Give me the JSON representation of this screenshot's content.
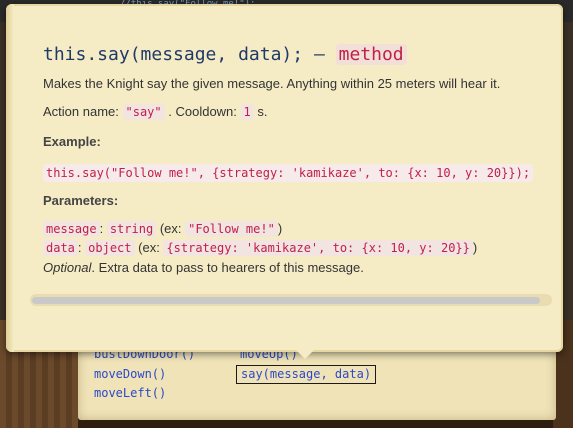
{
  "background_editor": {
    "snippet": "//this.say(\"Follow me!\");"
  },
  "popover": {
    "title_code": "this.say(message, data);",
    "title_dash": "–",
    "title_type": "method",
    "description": "Makes the Knight say the given message. Anything within 25 meters will hear it.",
    "action_name_label": "Action name:",
    "action_name_value": "\"say\"",
    "cooldown_label": ". Cooldown:",
    "cooldown_value": "1",
    "cooldown_unit": "s.",
    "example_heading": "Example:",
    "example_code": "this.say(\"Follow me!\", {strategy: 'kamikaze', to: {x: 10, y: 20}});",
    "parameters_heading": "Parameters:",
    "parameters": [
      {
        "name": "message",
        "colon": ":",
        "type": "string",
        "ex_prefix": "(ex:",
        "example": "\"Follow me!\"",
        "ex_suffix": ")"
      },
      {
        "name": "data",
        "colon": ":",
        "type": "object",
        "ex_prefix": "(ex:",
        "example": "{strategy: 'kamikaze', to: {x: 10, y: 20}}",
        "ex_suffix": ")"
      }
    ],
    "optional_label": "Optional",
    "optional_text": ". Extra data to pass to hearers of this message.",
    "scrollbar_fraction_visible": 0.98
  },
  "spell_palette": {
    "items": [
      {
        "label": "bustDownDoor()"
      },
      {
        "label": "moveUp()"
      },
      {
        "label": "moveDown()"
      },
      {
        "label": "say(message, data)",
        "selected": true
      },
      {
        "label": "moveLeft()"
      }
    ]
  },
  "colors": {
    "parchment": "#f5ecc6",
    "code_red": "#c0204a",
    "title_blue": "#1f3a66",
    "spell_blue": "#2b49c9"
  }
}
